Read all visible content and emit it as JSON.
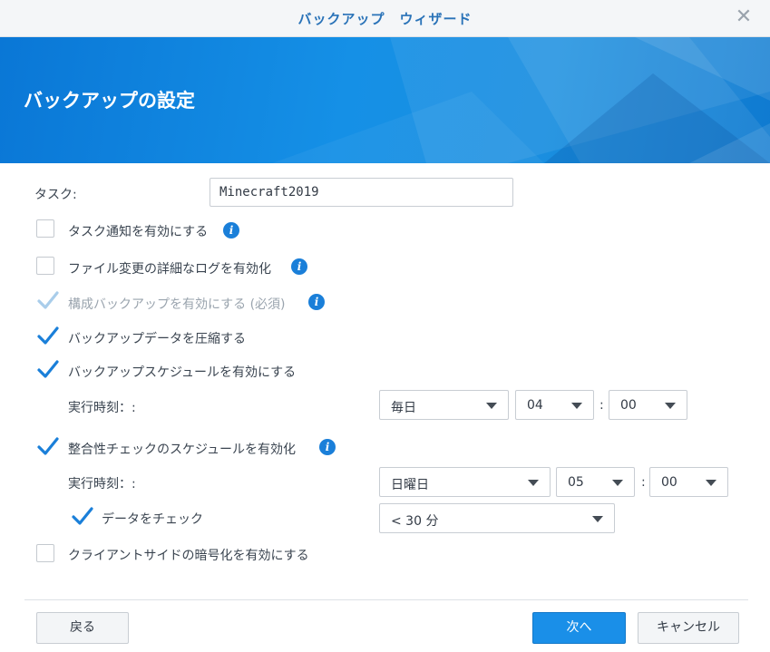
{
  "window": {
    "title": "バックアップ　ウィザード"
  },
  "banner": {
    "heading": "バックアップの設定"
  },
  "task": {
    "label": "タスク:",
    "value": "Minecraft2019"
  },
  "options": {
    "notify": {
      "label": "タスク通知を有効にする",
      "checked": false
    },
    "detail_log": {
      "label": "ファイル変更の詳細なログを有効化",
      "checked": false
    },
    "config_backup": {
      "label": "構成バックアップを有効にする (必須)",
      "checked": true,
      "disabled": true
    },
    "compress": {
      "label": "バックアップデータを圧縮する",
      "checked": true
    },
    "schedule": {
      "label": "バックアップスケジュールを有効にする",
      "checked": true
    },
    "integrity": {
      "label": "整合性チェックのスケジュールを有効化",
      "checked": true
    },
    "data_check": {
      "label": "データをチェック",
      "checked": true
    },
    "client_encrypt": {
      "label": "クライアントサイドの暗号化を有効にする",
      "checked": false
    }
  },
  "backup_schedule": {
    "time_label": "実行時刻：:",
    "frequency": "毎日",
    "hour": "04",
    "minute": "00"
  },
  "integrity_schedule": {
    "time_label": "実行時刻：:",
    "day": "日曜日",
    "hour": "05",
    "minute": "00",
    "duration": "< 30 分"
  },
  "footer": {
    "back_label": "戻る",
    "next_label": "次へ",
    "cancel_label": "キャンセル"
  },
  "colors": {
    "accent": "#1a8fe8",
    "banner": "#0a77d6",
    "title": "#2a73b8",
    "check": "#1a7fd9"
  },
  "icons": {
    "close": "close-icon",
    "info": "info-icon",
    "caret": "chevron-down-icon",
    "check": "checkmark-icon"
  }
}
